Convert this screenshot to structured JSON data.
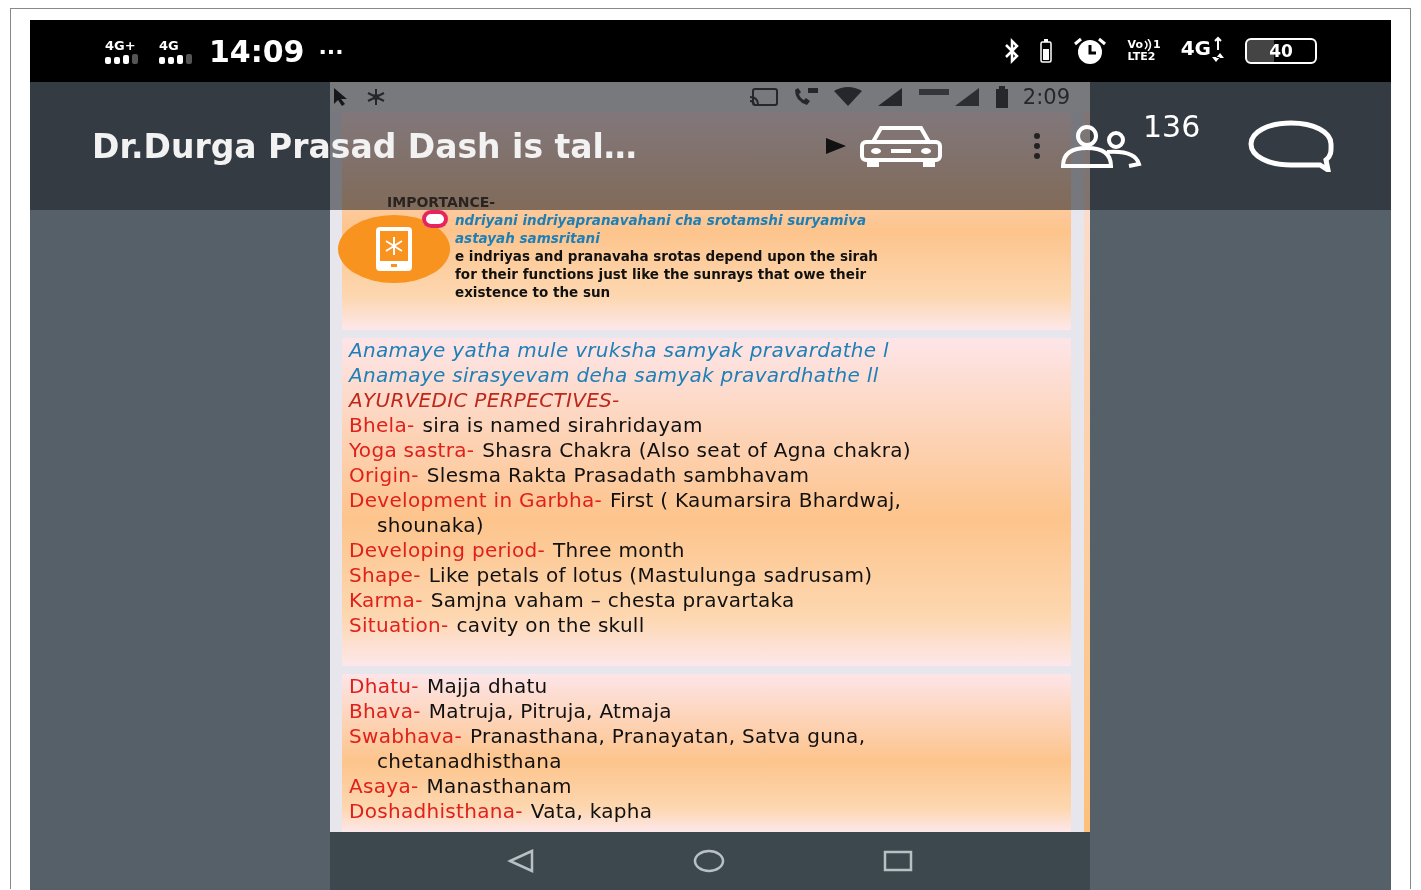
{
  "status_bar": {
    "networks": [
      {
        "label": "4G+"
      },
      {
        "label": "4G"
      }
    ],
    "time": "14:09",
    "more": "···",
    "volte": {
      "label": "Vo",
      "sim": "1",
      "network": "LTE2"
    },
    "data": "4G",
    "battery": "40"
  },
  "shared_screen": {
    "status_bar": {
      "time": "2:09"
    },
    "slides": [
      {
        "kind": "notes",
        "lines": [
          {
            "kind": "heading",
            "text": "IMPORTANCE-"
          },
          {
            "kind": "verse",
            "text": "ndriyani indriyapranavahani cha srotamshi suryamiva"
          },
          {
            "kind": "verse",
            "text": "astayah samsritani"
          },
          {
            "kind": "text",
            "text": "e indriyas and pranavaha srotas depend upon the sirah"
          },
          {
            "kind": "text",
            "text": "for their functions just like the sunrays that owe their"
          },
          {
            "kind": "text",
            "text": "existence to the sun"
          }
        ]
      },
      {
        "kind": "list",
        "lines": [
          {
            "kind": "verse",
            "text": "Anamaye yatha mule vruksha samyak pravardathe l"
          },
          {
            "kind": "verse",
            "text": "Anamaye sirasyevam deha samyak pravardhathe ll"
          },
          {
            "kind": "heading",
            "text": "AYURVEDIC PERPECTIVES-"
          },
          {
            "kind": "field",
            "label": "Bhela-",
            "value": "sira is named sirahridayam"
          },
          {
            "kind": "field",
            "label": "Yoga sastra-",
            "value": "Shasra Chakra (Also seat of Agna chakra)"
          },
          {
            "kind": "field",
            "label": "Origin-",
            "value": "Slesma Rakta Prasadath sambhavam"
          },
          {
            "kind": "field",
            "label": "Development in Garbha-",
            "value": "First ( Kaumarsira Bhardwaj,"
          },
          {
            "kind": "continuation",
            "text": "shounaka)"
          },
          {
            "kind": "field",
            "label": "Developing period-",
            "value": "Three month"
          },
          {
            "kind": "field",
            "label": "Shape-",
            "value": "Like petals of lotus (Mastulunga sadrusam)"
          },
          {
            "kind": "field",
            "label": "Karma-",
            "value": "Samjna vaham – chesta pravartaka"
          },
          {
            "kind": "field",
            "label": "Situation-",
            "value": "cavity on the skull"
          }
        ]
      },
      {
        "kind": "list",
        "lines": [
          {
            "kind": "field",
            "label": "Dhatu-",
            "value": "Majja dhatu"
          },
          {
            "kind": "field",
            "label": "Bhava-",
            "value": "Matruja, Pitruja, Atmaja"
          },
          {
            "kind": "field",
            "label": "Swabhava-",
            "value": "Pranasthana, Pranayatan, Satva guna,"
          },
          {
            "kind": "continuation",
            "text": "chetanadhisthana"
          },
          {
            "kind": "field",
            "label": "Asaya-",
            "value": "Manasthanam"
          },
          {
            "kind": "field",
            "label": "Doshadhisthana-",
            "value": "Vata, kapha"
          }
        ]
      }
    ]
  },
  "call_header": {
    "title": "Dr.Durga Prasad Dash is tal…",
    "participants": "136"
  }
}
